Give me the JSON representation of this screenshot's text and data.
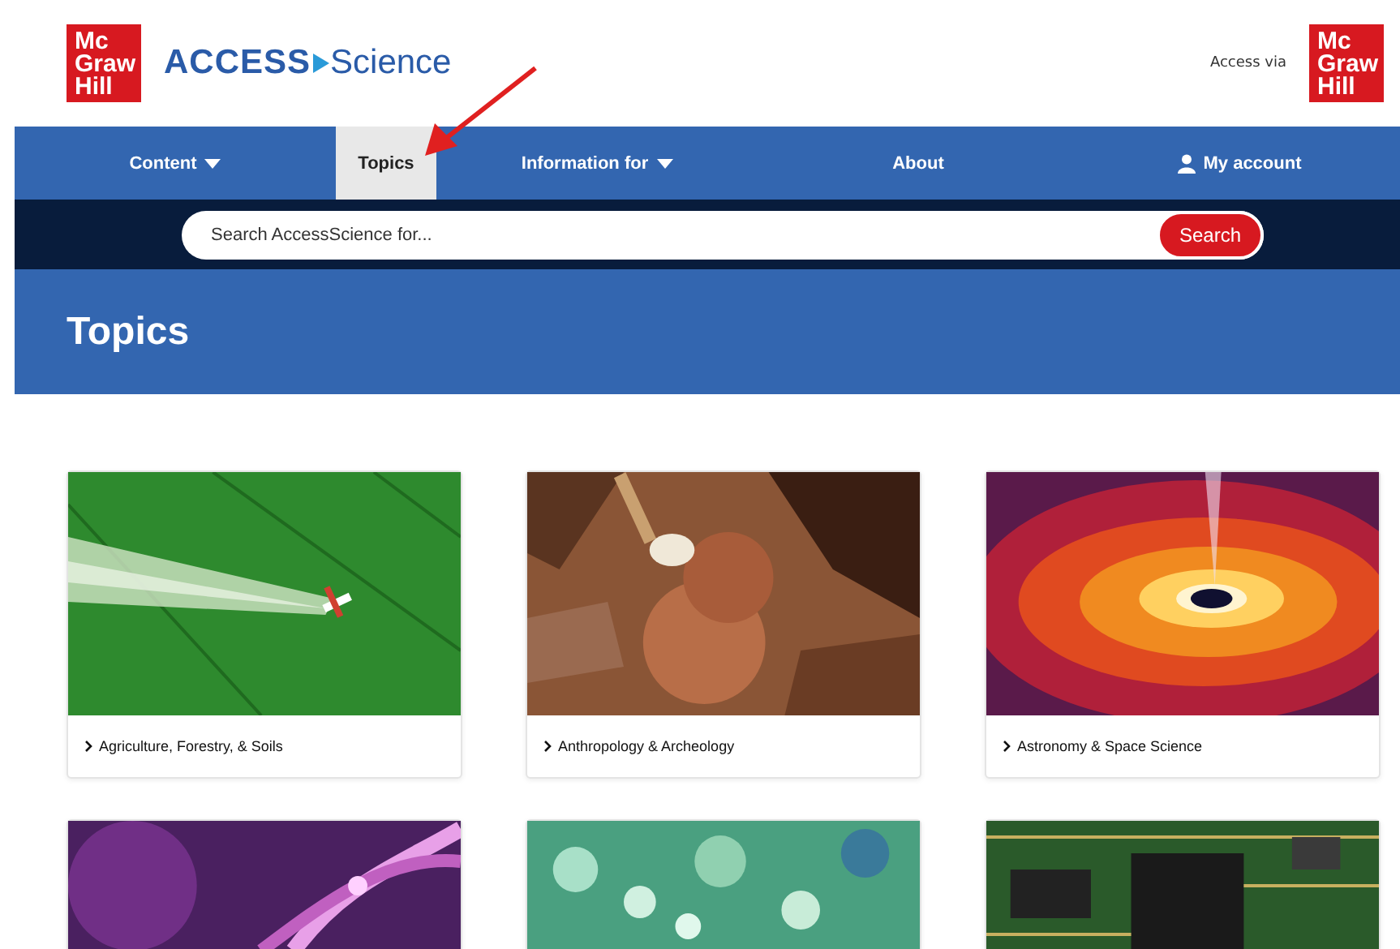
{
  "header": {
    "logo": [
      "Mc",
      "Graw",
      "Hill"
    ],
    "brand": {
      "part1": "ACCESS",
      "part2": "Science"
    },
    "access_label": "Access via",
    "access_logo": [
      "Mc",
      "Graw",
      "Hill"
    ]
  },
  "nav": [
    {
      "label": "Content",
      "dropdown": true,
      "kind": "link",
      "selected": false
    },
    {
      "label": "Topics",
      "dropdown": false,
      "kind": "link",
      "selected": true
    },
    {
      "label": "Information for",
      "dropdown": true,
      "kind": "link",
      "selected": false
    },
    {
      "label": "About",
      "dropdown": false,
      "kind": "link",
      "selected": false
    },
    {
      "label": "My account",
      "dropdown": false,
      "kind": "account",
      "selected": false
    }
  ],
  "search": {
    "placeholder": "Search AccessScience for...",
    "button": "Search"
  },
  "page_title": "Topics",
  "topics": [
    {
      "label": "Agriculture, Forestry, & Soils",
      "kind": "picture"
    },
    {
      "label": "Anthropology & Archeology",
      "kind": "picture"
    },
    {
      "label": "Astronomy & Space Science",
      "kind": "picture"
    },
    {
      "kind": "picture"
    },
    {
      "kind": "picture"
    },
    {
      "kind": "picture"
    }
  ]
}
